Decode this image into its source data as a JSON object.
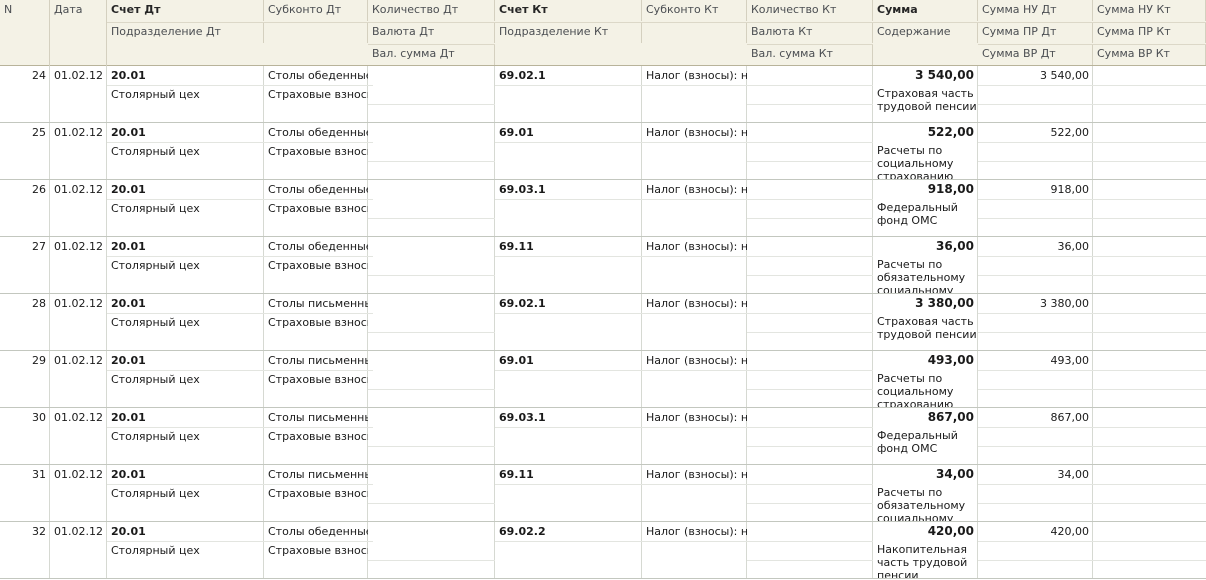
{
  "columns": {
    "n": "N",
    "date": "Дата",
    "schet_dt": "Счет Дт",
    "podr_dt": "Подразделение Дт",
    "subkonto_dt": "Субконто Дт",
    "kol_dt": "Количество Дт",
    "val_dt": "Валюта Дт",
    "valsum_dt": "Вал. сумма Дт",
    "schet_kt": "Счет Кт",
    "podr_kt": "Подразделение Кт",
    "subkonto_kt": "Субконто Кт",
    "kol_kt": "Количество Кт",
    "val_kt": "Валюта Кт",
    "valsum_kt": "Вал. сумма Кт",
    "summa": "Сумма",
    "soderzh": "Содержание",
    "nu_dt": "Сумма НУ Дт",
    "pr_dt": "Сумма ПР Дт",
    "vr_dt": "Сумма ВР Дт",
    "nu_kt": "Сумма НУ Кт",
    "pr_kt": "Сумма ПР Кт",
    "vr_kt": "Сумма ВР Кт"
  },
  "rows": [
    {
      "n": "24",
      "date": "01.02.12",
      "schet_dt": "20.01",
      "podr_dt": "Столярный цех",
      "subkonto_dt": "Столы обеденные",
      "subkonto_dt2": "Страховые взносы",
      "schet_kt": "69.02.1",
      "subkonto_kt": "Налог (взносы): на",
      "summa": "3 540,00",
      "soderzh": "Страховая часть трудовой пенсии",
      "nu_dt": "3 540,00"
    },
    {
      "n": "25",
      "date": "01.02.12",
      "schet_dt": "20.01",
      "podr_dt": "Столярный цех",
      "subkonto_dt": "Столы обеденные",
      "subkonto_dt2": "Страховые взносы",
      "schet_kt": "69.01",
      "subkonto_kt": "Налог (взносы): на",
      "summa": "522,00",
      "soderzh": "Расчеты по социальному страхованию",
      "nu_dt": "522,00"
    },
    {
      "n": "26",
      "date": "01.02.12",
      "schet_dt": "20.01",
      "podr_dt": "Столярный цех",
      "subkonto_dt": "Столы обеденные",
      "subkonto_dt2": "Страховые взносы",
      "schet_kt": "69.03.1",
      "subkonto_kt": "Налог (взносы): на",
      "summa": "918,00",
      "soderzh": "Федеральный фонд ОМС",
      "nu_dt": "918,00"
    },
    {
      "n": "27",
      "date": "01.02.12",
      "schet_dt": "20.01",
      "podr_dt": "Столярный цех",
      "subkonto_dt": "Столы обеденные",
      "subkonto_dt2": "Страховые взносы",
      "schet_kt": "69.11",
      "subkonto_kt": "Налог (взносы): на",
      "summa": "36,00",
      "soderzh": "Расчеты по обязательному социальному",
      "nu_dt": "36,00"
    },
    {
      "n": "28",
      "date": "01.02.12",
      "schet_dt": "20.01",
      "podr_dt": "Столярный цех",
      "subkonto_dt": "Столы письменные",
      "subkonto_dt2": "Страховые взносы",
      "schet_kt": "69.02.1",
      "subkonto_kt": "Налог (взносы): на",
      "summa": "3 380,00",
      "soderzh": "Страховая часть трудовой пенсии",
      "nu_dt": "3 380,00"
    },
    {
      "n": "29",
      "date": "01.02.12",
      "schet_dt": "20.01",
      "podr_dt": "Столярный цех",
      "subkonto_dt": "Столы письменные",
      "subkonto_dt2": "Страховые взносы",
      "schet_kt": "69.01",
      "subkonto_kt": "Налог (взносы): на",
      "summa": "493,00",
      "soderzh": "Расчеты по социальному страхованию",
      "nu_dt": "493,00"
    },
    {
      "n": "30",
      "date": "01.02.12",
      "schet_dt": "20.01",
      "podr_dt": "Столярный цех",
      "subkonto_dt": "Столы письменные",
      "subkonto_dt2": "Страховые взносы",
      "schet_kt": "69.03.1",
      "subkonto_kt": "Налог (взносы): на",
      "summa": "867,00",
      "soderzh": "Федеральный фонд ОМС",
      "nu_dt": "867,00"
    },
    {
      "n": "31",
      "date": "01.02.12",
      "schet_dt": "20.01",
      "podr_dt": "Столярный цех",
      "subkonto_dt": "Столы письменные",
      "subkonto_dt2": "Страховые взносы",
      "schet_kt": "69.11",
      "subkonto_kt": "Налог (взносы): на",
      "summa": "34,00",
      "soderzh": "Расчеты по обязательному социальному",
      "nu_dt": "34,00"
    },
    {
      "n": "32",
      "date": "01.02.12",
      "schet_dt": "20.01",
      "podr_dt": "Столярный цех",
      "subkonto_dt": "Столы обеденные",
      "subkonto_dt2": "Страховые взносы",
      "schet_kt": "69.02.2",
      "subkonto_kt": "Налог (взносы): на",
      "summa": "420,00",
      "soderzh": "Накопительная часть трудовой пенсии",
      "nu_dt": "420,00"
    }
  ]
}
